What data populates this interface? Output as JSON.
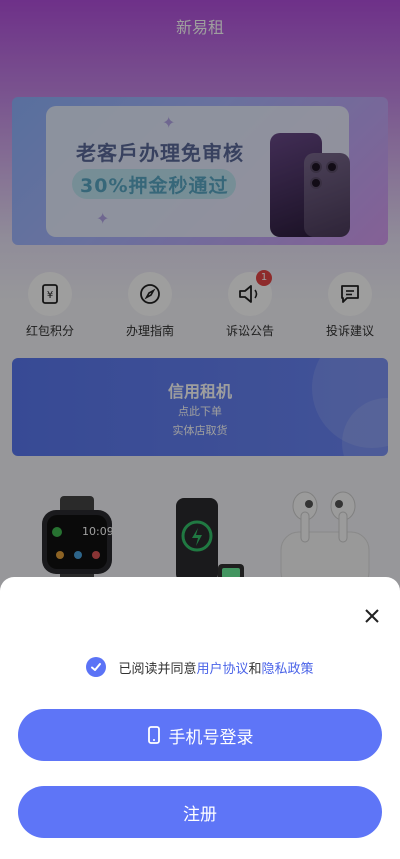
{
  "app": {
    "title": "新易租"
  },
  "banner": {
    "line1": "老客戶办理免审核",
    "line2": "30%押金秒通过"
  },
  "quick_menu": [
    {
      "label": "红包积分",
      "icon": "red-packet-icon"
    },
    {
      "label": "办理指南",
      "icon": "compass-icon"
    },
    {
      "label": "诉讼公告",
      "icon": "megaphone-icon",
      "badge": "1"
    },
    {
      "label": "投诉建议",
      "icon": "message-icon"
    }
  ],
  "credit": {
    "title": "信用租机",
    "line1": "点此下单",
    "line2": "实体店取货"
  },
  "products": [
    {
      "icon": "smartwatch-icon",
      "watch_time": "10:09"
    },
    {
      "icon": "wireless-charger-icon"
    },
    {
      "icon": "earbuds-icon"
    }
  ],
  "login_sheet": {
    "agree_prefix": "已阅读并同意",
    "user_agreement": "用户协议",
    "and": "和",
    "privacy_policy": "隐私政策",
    "login_button": "手机号登录",
    "register_button": "注册"
  },
  "colors": {
    "accent": "#5e75f7",
    "link": "#4a63e8",
    "badge": "#e64646"
  }
}
